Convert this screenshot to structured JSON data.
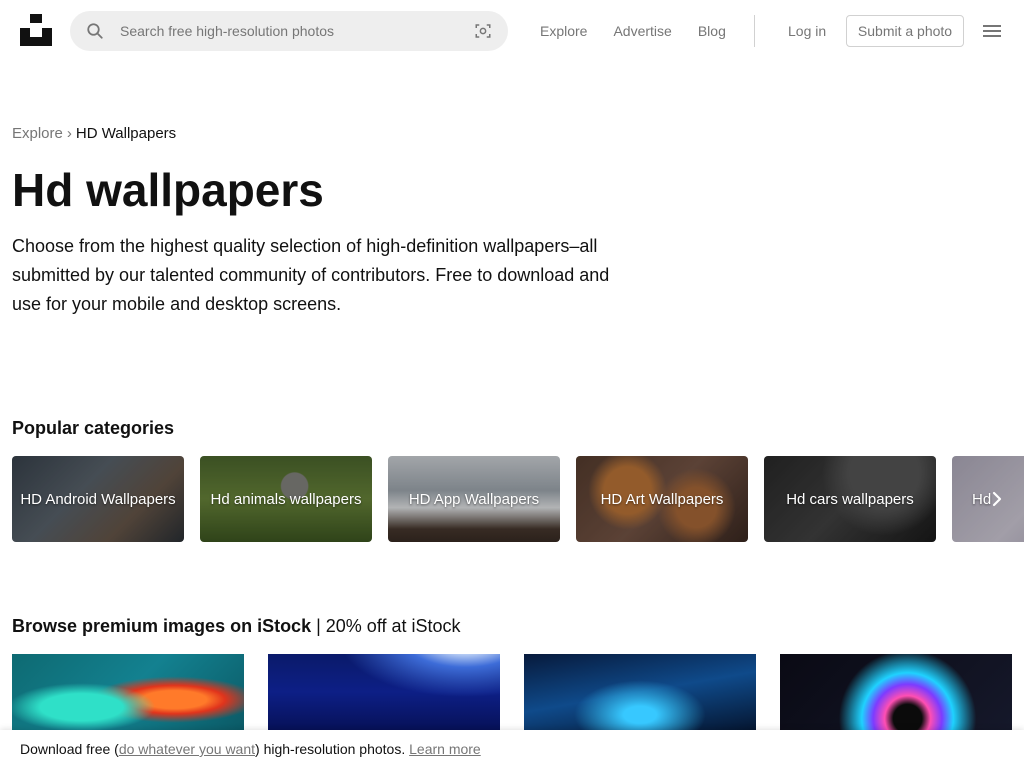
{
  "header": {
    "search_placeholder": "Search free high-resolution photos",
    "nav": [
      "Explore",
      "Advertise",
      "Blog"
    ],
    "login": "Log in",
    "submit": "Submit a photo"
  },
  "breadcrumb": {
    "parent": "Explore",
    "separator": "›",
    "current": "HD Wallpapers"
  },
  "page": {
    "title": "Hd wallpapers",
    "description": "Choose from the highest quality selection of high-definition wallpapers–all submitted by our talented community of contributors. Free to download and use for your mobile and desktop screens."
  },
  "categories": {
    "heading": "Popular categories",
    "items": [
      "HD Android Wallpapers",
      "Hd animals wallpapers",
      "HD App Wallpapers",
      "HD Art Wallpapers",
      "Hd cars wallpapers",
      "Hd"
    ]
  },
  "istock": {
    "heading": "Browse premium images on iStock",
    "separator": " | ",
    "offer": "20% off at iStock"
  },
  "banner": {
    "prefix": "Download free (",
    "link": "do whatever you want",
    "suffix": ") high-resolution photos.",
    "learn_more": "Learn more"
  },
  "colors": {
    "accent": "#111111",
    "muted": "#767676",
    "search_bg": "#eeeeee",
    "border": "#d1d1d1"
  }
}
